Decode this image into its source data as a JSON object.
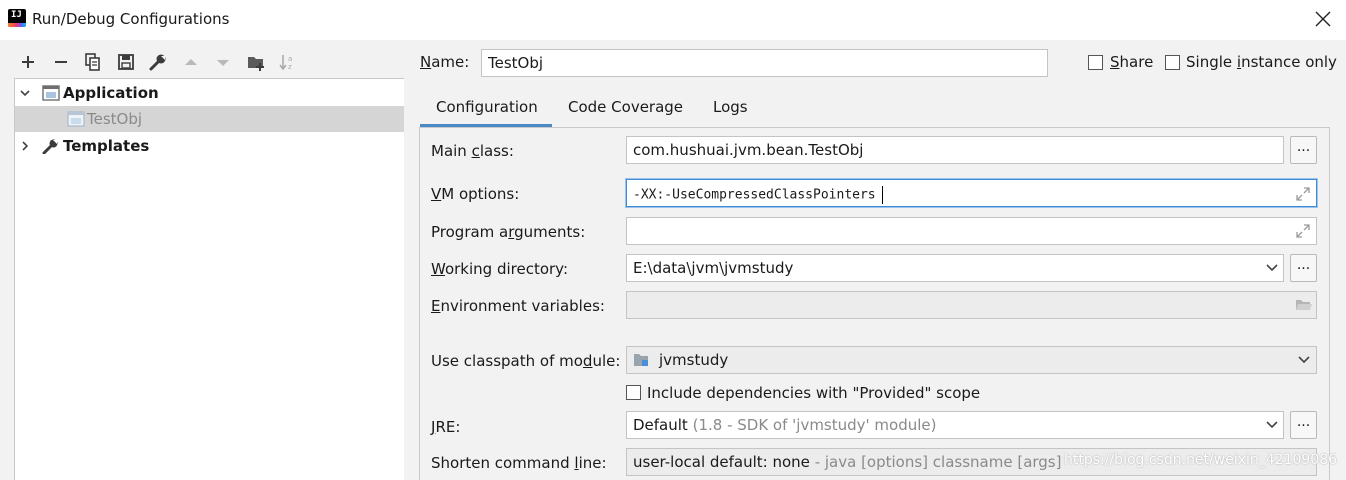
{
  "window": {
    "title": "Run/Debug Configurations",
    "app_icon_text": "IJ"
  },
  "toolbar": {
    "icons": [
      "plus-icon",
      "minus-icon",
      "copy-icon",
      "save-icon",
      "wrench-icon",
      "arrow-up-icon",
      "arrow-down-icon",
      "folder-add-icon",
      "sort-icon"
    ]
  },
  "tree": {
    "items": [
      {
        "label": "Application",
        "expanded": true,
        "bold": true
      },
      {
        "label": "TestObj",
        "selected": true
      },
      {
        "label": "Templates",
        "expanded": false,
        "bold": true
      }
    ]
  },
  "header": {
    "name_label_prefix": "N",
    "name_label_rest": "ame:",
    "name_value": "TestObj",
    "share_label_prefix": "S",
    "share_label_rest": "hare",
    "single_label_pre": "Single ",
    "single_label_u": "i",
    "single_label_post": "nstance only",
    "share_checked": false,
    "single_checked": false
  },
  "tabs": [
    {
      "label": "Configuration",
      "active": true
    },
    {
      "label": "Code Coverage",
      "active": false
    },
    {
      "label": "Logs",
      "active": false
    }
  ],
  "form": {
    "main_class": {
      "label_pre": "Main ",
      "label_u": "c",
      "label_post": "lass:",
      "value": "com.hushuai.jvm.bean.TestObj",
      "button": "..."
    },
    "vm_options": {
      "label_u": "V",
      "label_post": "M options:",
      "value": "-XX:-UseCompressedClassPointers"
    },
    "program_args": {
      "label_pre": "Program a",
      "label_u": "r",
      "label_post": "guments:",
      "value": ""
    },
    "working_dir": {
      "label_u": "W",
      "label_post": "orking directory:",
      "value": "E:\\data\\jvm\\jvmstudy",
      "button": "..."
    },
    "env_vars": {
      "label_u": "E",
      "label_post": "nvironment variables:",
      "value": ""
    },
    "classpath_module": {
      "label_pre": "Use classpath of mo",
      "label_u": "d",
      "label_post": "ule:",
      "value": "jvmstudy"
    },
    "include_deps": {
      "label": "Include dependencies with \"Provided\" scope",
      "checked": false
    },
    "jre": {
      "label_u": "J",
      "label_post": "RE:",
      "value": "Default",
      "hint": "(1.8 - SDK of 'jvmstudy' module)",
      "button": "..."
    },
    "shorten_cmd": {
      "label_pre": "Shorten command ",
      "label_u": "l",
      "label_post": "ine:",
      "value": "user-local default: none",
      "hint": "- java [options] classname [args]"
    }
  },
  "watermark": "https://blog.csdn.net/weixin_42109086",
  "colors": {
    "accent": "#4a88c7",
    "selection": "#d5d5d5",
    "focus": "#3d8dd6"
  }
}
